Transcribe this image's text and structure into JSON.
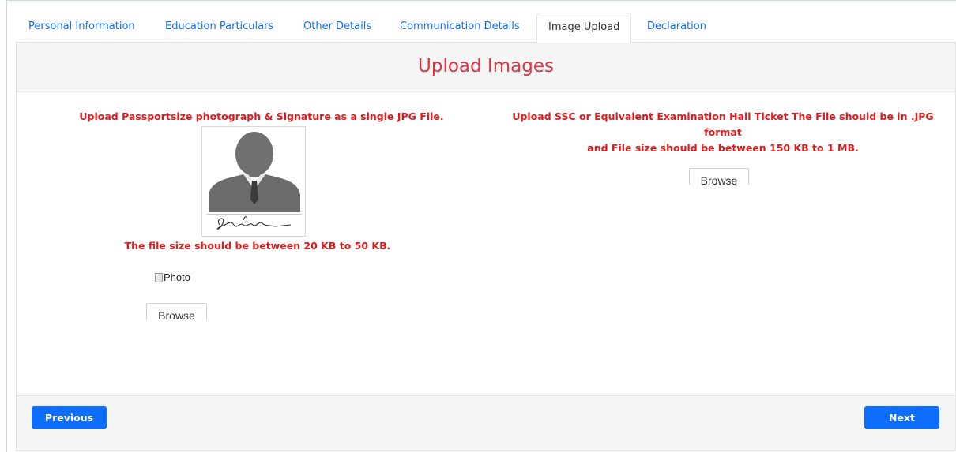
{
  "tabs": [
    {
      "label": "Personal Information",
      "active": false
    },
    {
      "label": "Education Particulars",
      "active": false
    },
    {
      "label": "Other Details",
      "active": false
    },
    {
      "label": "Communication Details",
      "active": false
    },
    {
      "label": "Image Upload",
      "active": true
    },
    {
      "label": "Declaration",
      "active": false
    }
  ],
  "panel": {
    "title": "Upload Images"
  },
  "photo_section": {
    "instruction": "Upload Passportsize photograph & Signature as a single JPG File.",
    "size_note": "The file size should be between 20 KB to 50 KB.",
    "photo_alt": "Photo",
    "browse_label": "Browse",
    "sample_icon": "photo-signature-sample-icon"
  },
  "hall_ticket_section": {
    "instruction_line1": "Upload SSC or Equivalent Examination Hall Ticket The File should be in .JPG",
    "instruction_line2": "format",
    "instruction_line3": "and File size should be between 150 KB to 1 MB.",
    "browse_label": "Browse"
  },
  "footer": {
    "previous_label": "Previous",
    "next_label": "Next"
  },
  "colors": {
    "link_blue": "#0d6efd",
    "title_red": "#dc3545",
    "warning_red": "#e01a1a",
    "header_bg": "#f5f5f5"
  }
}
